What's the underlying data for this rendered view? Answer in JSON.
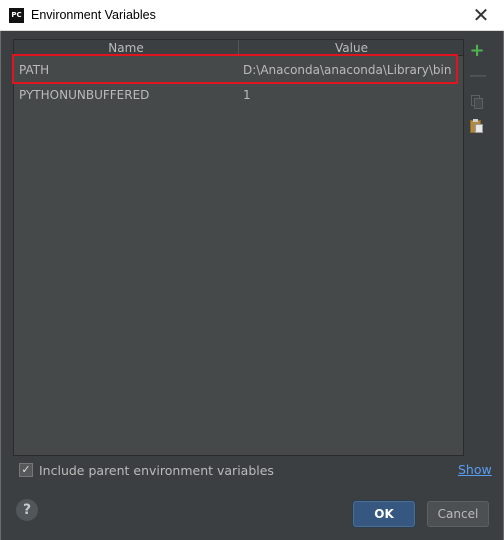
{
  "window": {
    "title": "Environment Variables",
    "app_logo": "PC",
    "close_glyph": "✕"
  },
  "table": {
    "columns": [
      "Name",
      "Value"
    ],
    "rows": [
      {
        "name": "PATH",
        "value": "D:\\Anaconda\\anaconda\\Library\\bin"
      },
      {
        "name": "PYTHONUNBUFFERED",
        "value": "1"
      }
    ]
  },
  "toolbar": {
    "add_glyph": "+",
    "remove_glyph": "—",
    "icons": [
      "plus-icon",
      "minus-icon",
      "copy-icon",
      "paste-icon"
    ]
  },
  "options": {
    "include_parent_label": "Include parent environment variables",
    "include_parent_checked": true,
    "check_glyph": "✓",
    "show_link": "Show"
  },
  "footer": {
    "help_glyph": "?",
    "ok_label": "OK",
    "cancel_label": "Cancel"
  },
  "colors": {
    "background": "#3c3f41",
    "table_background": "#45494a",
    "highlight_border": "#e0141e",
    "ok_button": "#365880",
    "link": "#589df6",
    "add_icon": "#4eb34e"
  }
}
